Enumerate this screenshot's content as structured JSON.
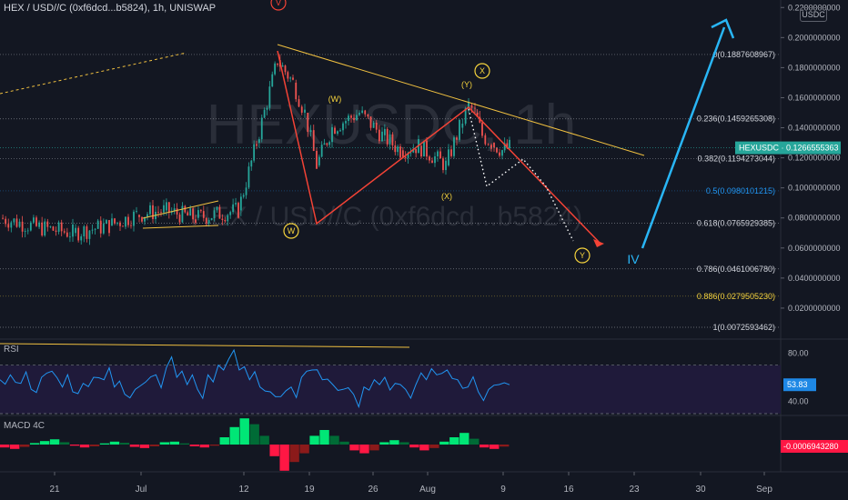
{
  "header": {
    "symbol_line": "HEX / USD//C (0xf6dcd...b5824), 1h, UNISWAP",
    "currency_button": "USDC"
  },
  "watermark": {
    "big": "HEXUSDC, 1h",
    "small": "HEX / USD//C (0xf6dcd...b5824)"
  },
  "chart_data": [
    {
      "type": "line",
      "title": "HEX / USD//C (0xf6dcd...b5824), 1h, UNISWAP",
      "x_ticks": [
        "21",
        "Jul",
        "12",
        "19",
        "26",
        "Aug",
        "9",
        "16",
        "23",
        "30",
        "Sep"
      ],
      "y_ticks": [
        0.02,
        0.04,
        0.06,
        0.08,
        0.1,
        0.12,
        0.14,
        0.16,
        0.18,
        0.2,
        0.22
      ],
      "y_tick_labels": [
        "0.0200000000",
        "0.0400000000",
        "0.0600000000",
        "0.0800000000",
        "0.1000000000",
        "0.1200000000",
        "0.1400000000",
        "0.1600000000",
        "0.1800000000",
        "0.2000000000",
        "0.2200000000"
      ],
      "ylim": [
        0.0,
        0.225
      ],
      "current_label": "HEXUSDC",
      "current_value": "0.1266555363",
      "price_series": {
        "x_dates": [
          "2021-06-15",
          "2021-06-19",
          "2021-06-23",
          "2021-06-27",
          "2021-07-01",
          "2021-07-05",
          "2021-07-09",
          "2021-07-12",
          "2021-07-14",
          "2021-07-15",
          "2021-07-16",
          "2021-07-17",
          "2021-07-19",
          "2021-07-20",
          "2021-07-22",
          "2021-07-24",
          "2021-07-26",
          "2021-07-28",
          "2021-07-31",
          "2021-08-02",
          "2021-08-04",
          "2021-08-05",
          "2021-08-06",
          "2021-08-07",
          "2021-08-08",
          "2021-08-09"
        ],
        "values": [
          0.08,
          0.074,
          0.07,
          0.075,
          0.082,
          0.085,
          0.08,
          0.085,
          0.13,
          0.185,
          0.17,
          0.15,
          0.115,
          0.14,
          0.15,
          0.135,
          0.125,
          0.128,
          0.115,
          0.14,
          0.155,
          0.15,
          0.135,
          0.13,
          0.125,
          0.127
        ]
      },
      "fib_levels": [
        {
          "label": "0(0.1887608967)",
          "value": 0.1887608967,
          "color": "#d1d4dc"
        },
        {
          "label": "0.236(0.1459265308)",
          "value": 0.1459265308,
          "color": "#d1d4dc"
        },
        {
          "label": "0.382(0.1194273044)",
          "value": 0.1194273044,
          "color": "#d1d4dc"
        },
        {
          "label": "0.5(0.0980101215)",
          "value": 0.0980101215,
          "color": "#2196f3"
        },
        {
          "label": "0.618(0.0765929385)",
          "value": 0.0765929385,
          "color": "#d1d4dc"
        },
        {
          "label": "0.786(0.0461006780)",
          "value": 0.046100678,
          "color": "#d1d4dc"
        },
        {
          "label": "0.886(0.0279505230)",
          "value": 0.027950523,
          "color": "#f5d33d"
        },
        {
          "label": "1(0.0072593462)",
          "value": 0.0072593462,
          "color": "#d1d4dc"
        }
      ],
      "wave_labels": [
        "V",
        "(W)",
        "W",
        "(Y)",
        "X",
        "(X)",
        "Y",
        "IV"
      ],
      "colors": {
        "up": "#26a69a",
        "down": "#ef5350",
        "trendline": "#f0c040",
        "wave": "#f44336",
        "impulse": "#29b6f6"
      }
    },
    {
      "type": "line",
      "title": "RSI",
      "y_ticks": [
        40.0,
        80.0
      ],
      "y_tick_labels": [
        "40.00",
        "80.00"
      ],
      "ylim": [
        30,
        90
      ],
      "current_value": "53.83",
      "series": [
        {
          "values": [
            58,
            62,
            55,
            50,
            60,
            65,
            52,
            48,
            55,
            60,
            58,
            52,
            46,
            50,
            56,
            62,
            68,
            60,
            54,
            50,
            62,
            70,
            75,
            66,
            58,
            52,
            48,
            44,
            52,
            60,
            66,
            58,
            54,
            50,
            46,
            52,
            58,
            60,
            55,
            50,
            54,
            58,
            62,
            66,
            58,
            52,
            48,
            50,
            54,
            53.83
          ]
        }
      ],
      "color": "#2196f3"
    },
    {
      "type": "bar",
      "title": "MACD 4C",
      "current_value": "-0.0006943280",
      "values": [
        -0.001,
        -0.0015,
        -0.0008,
        0.0005,
        0.0012,
        0.0018,
        0.0008,
        -0.0004,
        -0.001,
        -0.0006,
        0.0004,
        0.001,
        0.0006,
        -0.0008,
        -0.0012,
        -0.0006,
        0.0008,
        0.001,
        0.0004,
        -0.0006,
        -0.001,
        -0.0004,
        0.0025,
        0.006,
        0.009,
        0.007,
        0.003,
        -0.004,
        -0.009,
        -0.006,
        -0.003,
        0.003,
        0.005,
        0.003,
        0.001,
        -0.002,
        -0.003,
        -0.002,
        0.0008,
        0.0015,
        0.0008,
        -0.001,
        -0.002,
        -0.0012,
        0.001,
        0.0025,
        0.004,
        0.002,
        -0.001,
        -0.0015,
        -0.0007
      ],
      "colors": {
        "pos_up": "#00e676",
        "pos_down": "#006b36",
        "neg_down": "#ff1744",
        "neg_up": "#8b1a1a"
      }
    }
  ]
}
